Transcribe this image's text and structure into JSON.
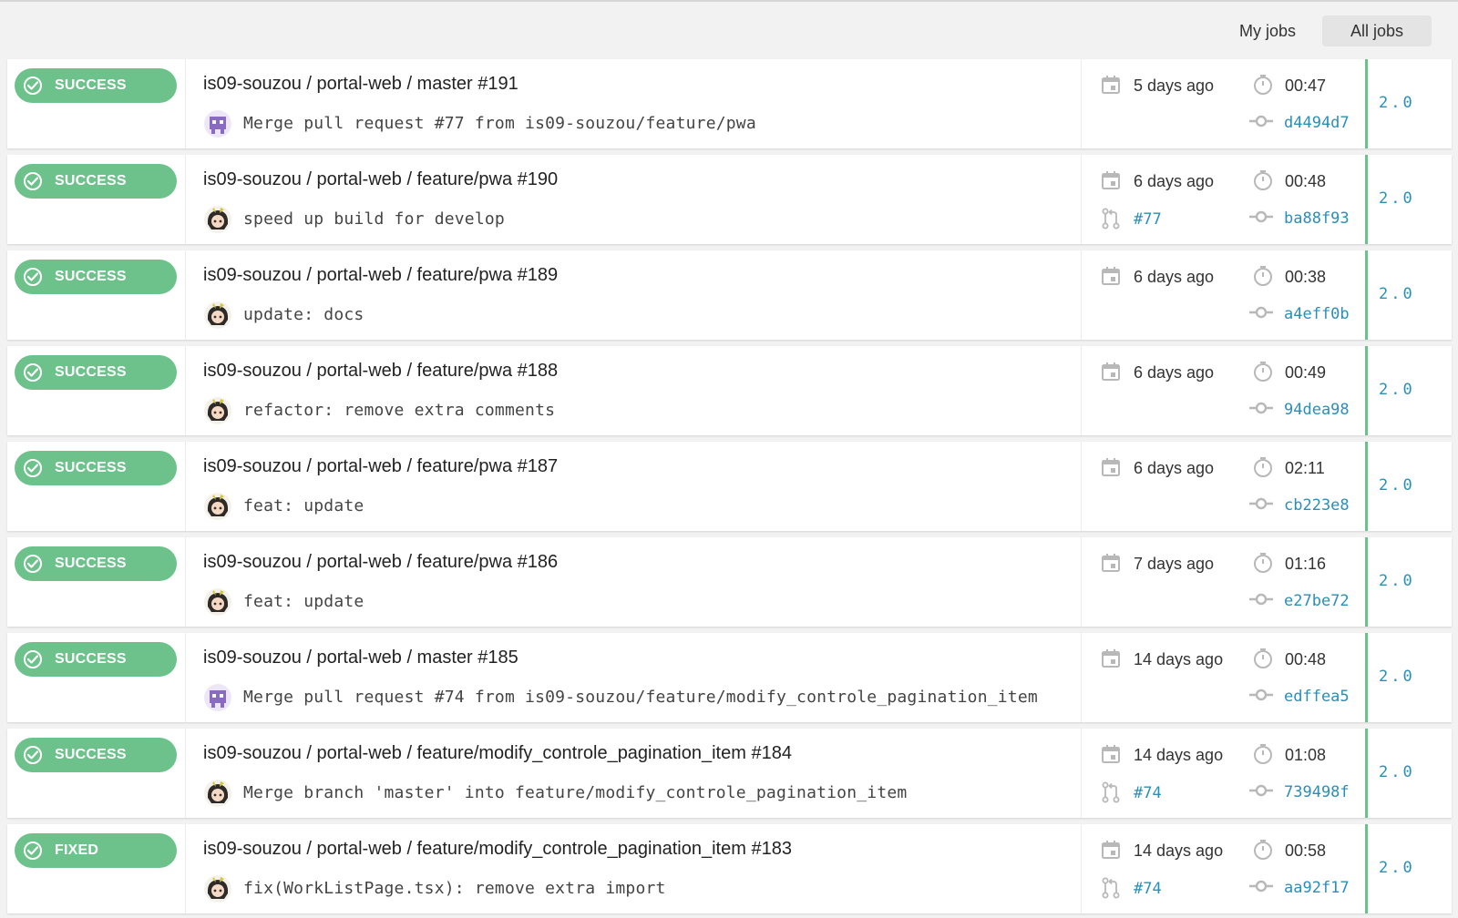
{
  "filters": {
    "my_jobs": "My jobs",
    "all_jobs": "All jobs"
  },
  "colors": {
    "success": "#6cc28a",
    "link": "#2a8fb8"
  },
  "jobs": [
    {
      "status": "SUCCESS",
      "title": "is09-souzou / portal-web / master #191",
      "message": "Merge pull request #77 from is09-souzou/feature/pwa",
      "avatar": "purple-avatar",
      "time_ago": "5 days ago",
      "duration": "00:47",
      "pr": "",
      "commit": "d4494d7",
      "version": "2.0"
    },
    {
      "status": "SUCCESS",
      "title": "is09-souzou / portal-web / feature/pwa #190",
      "message": "speed up build for develop",
      "avatar": "anime-avatar",
      "time_ago": "6 days ago",
      "duration": "00:48",
      "pr": "#77",
      "commit": "ba88f93",
      "version": "2.0"
    },
    {
      "status": "SUCCESS",
      "title": "is09-souzou / portal-web / feature/pwa #189",
      "message": "update: docs",
      "avatar": "anime-avatar",
      "time_ago": "6 days ago",
      "duration": "00:38",
      "pr": "",
      "commit": "a4eff0b",
      "version": "2.0"
    },
    {
      "status": "SUCCESS",
      "title": "is09-souzou / portal-web / feature/pwa #188",
      "message": "refactor: remove extra comments",
      "avatar": "anime-avatar",
      "time_ago": "6 days ago",
      "duration": "00:49",
      "pr": "",
      "commit": "94dea98",
      "version": "2.0"
    },
    {
      "status": "SUCCESS",
      "title": "is09-souzou / portal-web / feature/pwa #187",
      "message": "feat: update",
      "avatar": "anime-avatar",
      "time_ago": "6 days ago",
      "duration": "02:11",
      "pr": "",
      "commit": "cb223e8",
      "version": "2.0"
    },
    {
      "status": "SUCCESS",
      "title": "is09-souzou / portal-web / feature/pwa #186",
      "message": "feat: update",
      "avatar": "anime-avatar",
      "time_ago": "7 days ago",
      "duration": "01:16",
      "pr": "",
      "commit": "e27be72",
      "version": "2.0"
    },
    {
      "status": "SUCCESS",
      "title": "is09-souzou / portal-web / master #185",
      "message": "Merge pull request #74 from is09-souzou/feature/modify_controle_pagination_item",
      "avatar": "purple-avatar",
      "time_ago": "14 days ago",
      "duration": "00:48",
      "pr": "",
      "commit": "edffea5",
      "version": "2.0"
    },
    {
      "status": "SUCCESS",
      "title": "is09-souzou / portal-web / feature/modify_controle_pagination_item #184",
      "message": "Merge branch 'master' into feature/modify_controle_pagination_item",
      "avatar": "anime-avatar",
      "time_ago": "14 days ago",
      "duration": "01:08",
      "pr": "#74",
      "commit": "739498f",
      "version": "2.0"
    },
    {
      "status": "FIXED",
      "title": "is09-souzou / portal-web / feature/modify_controle_pagination_item #183",
      "message": "fix(WorkListPage.tsx): remove extra import",
      "avatar": "anime-avatar",
      "time_ago": "14 days ago",
      "duration": "00:58",
      "pr": "#74",
      "commit": "aa92f17",
      "version": "2.0"
    }
  ]
}
